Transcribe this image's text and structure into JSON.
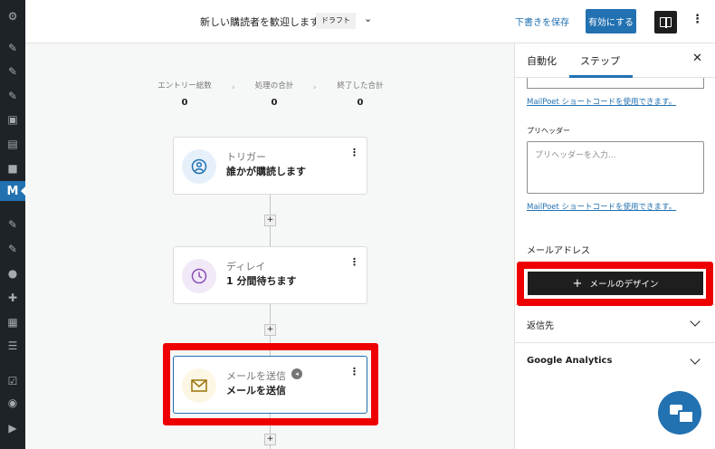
{
  "wp_sidebar": {
    "icons": [
      "gear-icon",
      "pin-icon",
      "pin-icon",
      "pin-icon",
      "media-icon",
      "pages-icon",
      "comments-icon",
      "mailpoet-logo",
      "appearance-icon",
      "plugins-icon",
      "users-icon",
      "tools-icon",
      "settings-icon",
      "list-icon",
      "checklist-icon",
      "circle-icon",
      "play-icon"
    ],
    "mailpoet_label": "M"
  },
  "header": {
    "title": "新しい購読者を歓迎します",
    "status_badge": "ドラフト",
    "save_draft_label": "下書きを保存",
    "activate_label": "有効にする"
  },
  "stats": [
    {
      "label": "エントリー総数",
      "value": "0"
    },
    {
      "label": "処理の合計",
      "value": "0"
    },
    {
      "label": "終了した合計",
      "value": "0"
    }
  ],
  "steps": [
    {
      "type": "トリガー",
      "name": "誰かが購読します",
      "icon": "user-icon"
    },
    {
      "type": "ディレイ",
      "name": "1 分間待ちます",
      "icon": "clock-icon"
    },
    {
      "type": "メールを送信",
      "name": "メールを送信",
      "icon": "envelope-icon"
    }
  ],
  "add_step_label": "+",
  "panel": {
    "tabs": [
      "自動化",
      "ステップ"
    ],
    "active_tab": "ステップ",
    "shortcode_link": "MailPoet ショートコードを使用できます。",
    "preheader_label": "プリヘッダー",
    "preheader_placeholder": "プリヘッダーを入力...",
    "email_label": "メールアドレス",
    "design_button": "メールのデザイン",
    "sections": [
      {
        "title": "返信先"
      },
      {
        "title": "Google Analytics"
      }
    ]
  },
  "colors": {
    "accent": "#2271b1",
    "highlight": "#ee0000",
    "wp_sidebar": "#1d2327",
    "trigger_icon_bg": "#e6f0fa",
    "delay_icon_bg": "#f1e9f7",
    "email_icon_bg": "#fcf6e5"
  }
}
